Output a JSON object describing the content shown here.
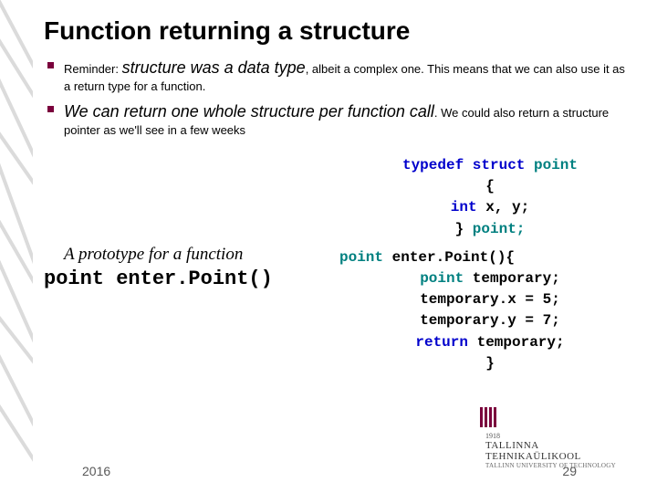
{
  "title": "Function returning a structure",
  "bullets": [
    {
      "pre": "Reminder: ",
      "emph": "structure was a data type",
      "post": ", albeit a complex one. This means that we can also use it as a return type for a function."
    },
    {
      "pre": "",
      "emph": "We can return one whole structure per function call",
      "post": ". We could also return a structure pointer as we'll see in a few weeks"
    }
  ],
  "proto_label": "A prototype for a function",
  "proto": "point enter.Point()",
  "code": {
    "l1a": "typedef struct ",
    "l1b": "point",
    "l2": "{",
    "l3a": "int ",
    "l3b": "x, y;",
    "l4a": "} ",
    "l4b": "point;",
    "l5a": "point ",
    "l5b": "enter.Point(){",
    "l6a": "point ",
    "l6b": "temporary;",
    "l7a": "temporary.x ",
    "l7b": "= 5;",
    "l8a": "temporary.y ",
    "l8b": "= 7;",
    "l9a": "return ",
    "l9b": "temporary;",
    "l10": "}"
  },
  "logo": {
    "year": "1918",
    "line1": "TALLINNA TEHNIKAÜLIKOOL",
    "line2": "TALLINN UNIVERSITY OF TECHNOLOGY"
  },
  "footer": {
    "year": "2016",
    "page": "29"
  }
}
